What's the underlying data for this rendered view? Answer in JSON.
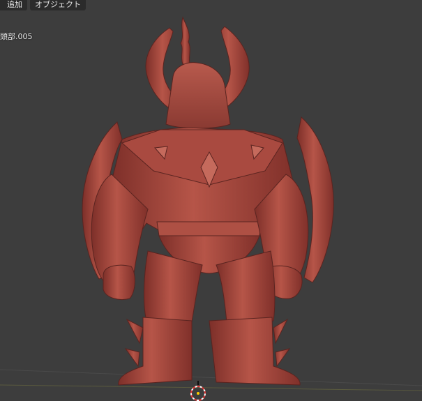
{
  "header": {
    "menu": [
      {
        "label": "追加"
      },
      {
        "label": "オブジェクト"
      }
    ]
  },
  "viewport": {
    "active_object_label": "頭部.005",
    "model_color": "#a8493f",
    "background_color": "#3d3d3d",
    "icons": [
      "3d-cursor-icon"
    ]
  }
}
